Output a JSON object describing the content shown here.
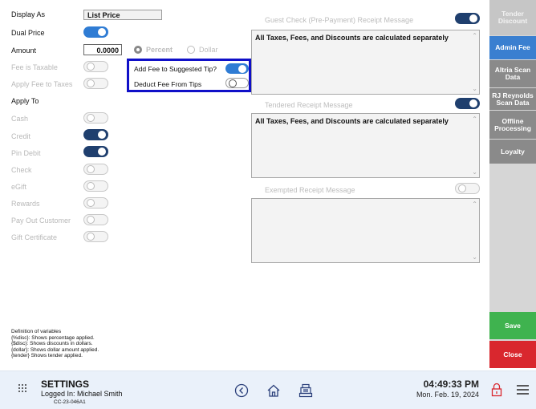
{
  "left": {
    "display_as_label": "Display As",
    "display_as_value": "List Price",
    "dual_price_label": "Dual Price",
    "amount_label": "Amount",
    "amount_value": "0.0000",
    "percent_label": "Percent",
    "dollar_label": "Dollar",
    "fee_taxable_label": "Fee is Taxable",
    "apply_fee_taxes_label": "Apply Fee to Taxes",
    "apply_to_label": "Apply To",
    "apply_items": [
      "Cash",
      "Credit",
      "Pin Debit",
      "Check",
      "eGift",
      "Rewards",
      "Pay Out Customer",
      "Gift Certificate"
    ],
    "apply_states": [
      "off",
      "on",
      "on",
      "off",
      "off",
      "off",
      "off",
      "off"
    ]
  },
  "popup": {
    "tip_label": "Add Fee to Suggested Tip?",
    "deduct_label": "Deduct Fee From Tips"
  },
  "right": {
    "guest_check_label": "Guest Check (Pre-Payment) Receipt Message",
    "guest_check_text": "All Taxes, Fees, and Discounts are calculated separately",
    "tendered_label": "Tendered Receipt Message",
    "tendered_text": "All Taxes, Fees, and Discounts are calculated separately",
    "exempted_label": "Exempted Receipt Message",
    "exempted_text": ""
  },
  "definitions": [
    "Definition of variables",
    "{%disc}: Shows percentage applied.",
    "{$disc}: Shows discounts in dollars.",
    "{dollar}: Shows dollar amount applied.",
    "{tender} Shows tender applied."
  ],
  "sidebar": {
    "tabs": [
      "Tender Discount",
      "Admin Fee",
      "Altria Scan Data",
      "RJ Reynolds Scan Data",
      "Offline Processing",
      "Loyalty"
    ],
    "save": "Save",
    "close": "Close"
  },
  "footer": {
    "title": "SETTINGS",
    "logged_in": "Logged In:  Michael Smith",
    "device_id": "CC-23-046A1",
    "time": "04:49:33 PM",
    "date": "Mon. Feb. 19, 2024"
  },
  "colors": {
    "toggle_on": "#1f3f6e",
    "active_tab": "#3a7fd0",
    "save": "#3fb34f",
    "close": "#d9272e",
    "annotation": "#1a1ae0"
  }
}
